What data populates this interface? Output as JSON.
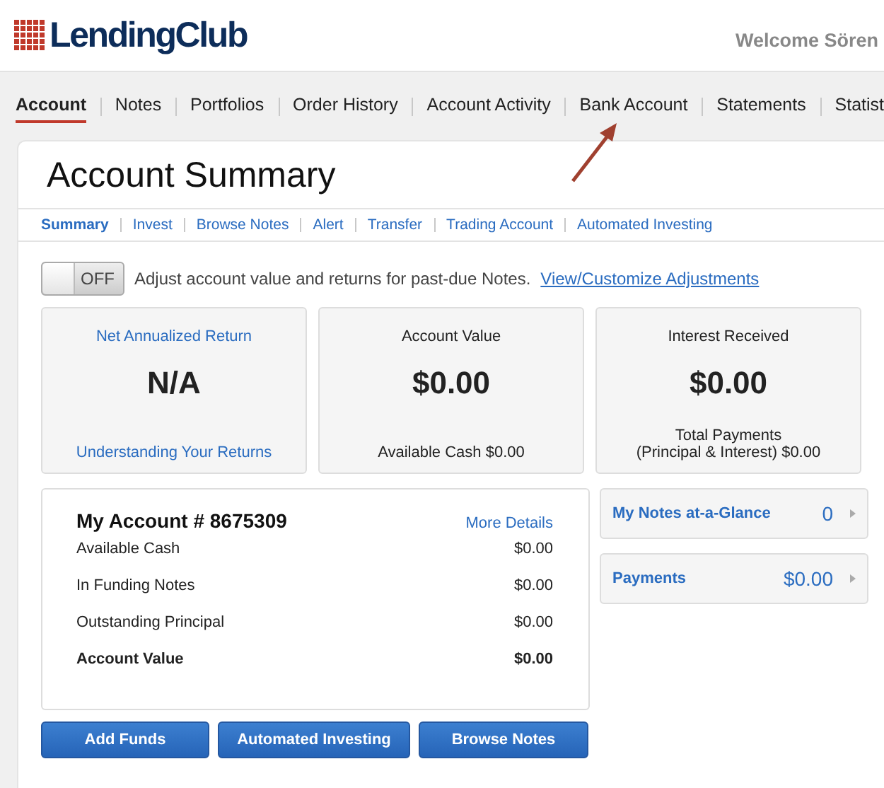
{
  "header": {
    "logo": "LendingClub",
    "welcome": "Welcome Sören"
  },
  "nav": [
    {
      "label": "Account",
      "selected": true
    },
    {
      "label": "Notes",
      "selected": false
    },
    {
      "label": "Portfolios",
      "selected": false
    },
    {
      "label": "Order History",
      "selected": false
    },
    {
      "label": "Account Activity",
      "selected": false
    },
    {
      "label": "Bank Account",
      "selected": false
    },
    {
      "label": "Statements",
      "selected": false
    },
    {
      "label": "Statist",
      "selected": false
    }
  ],
  "page_title": "Account Summary",
  "subnav": [
    {
      "label": "Summary",
      "selected": true
    },
    {
      "label": "Invest",
      "selected": false
    },
    {
      "label": "Browse Notes",
      "selected": false
    },
    {
      "label": "Alert",
      "selected": false
    },
    {
      "label": "Transfer",
      "selected": false
    },
    {
      "label": "Trading Account",
      "selected": false
    },
    {
      "label": "Automated Investing",
      "selected": false
    }
  ],
  "adjustment": {
    "toggle_label": "OFF",
    "on": false,
    "text": "Adjust account value and returns for past-due Notes.",
    "link": "View/Customize Adjustments"
  },
  "cards": [
    {
      "kind": "link",
      "title": "Net Annualized Return",
      "value": "N/A",
      "footer": [
        "Understanding Your Returns"
      ]
    },
    {
      "kind": "plain",
      "title": "Account Value",
      "value": "$0.00",
      "footer": [
        "Available Cash $0.00"
      ]
    },
    {
      "kind": "plain",
      "title": "Interest Received",
      "value": "$0.00",
      "footer": [
        "Total Payments",
        "(Principal & Interest) $0.00"
      ]
    }
  ],
  "my_account": {
    "title": "My Account # 8675309",
    "link": "More Details",
    "rows": [
      {
        "label": "Available Cash",
        "value": "$0.00",
        "total": false
      },
      {
        "label": "In Funding Notes",
        "value": "$0.00",
        "total": false
      },
      {
        "label": "Outstanding Principal",
        "value": "$0.00",
        "total": false
      },
      {
        "label": "Account Value",
        "value": "$0.00",
        "total": true
      }
    ]
  },
  "side_panels": [
    {
      "label": "My Notes at-a-Glance",
      "value": "0"
    },
    {
      "label": "Payments",
      "value": "$0.00"
    }
  ],
  "buttons": [
    "Add Funds",
    "Automated Investing",
    "Browse Notes"
  ]
}
